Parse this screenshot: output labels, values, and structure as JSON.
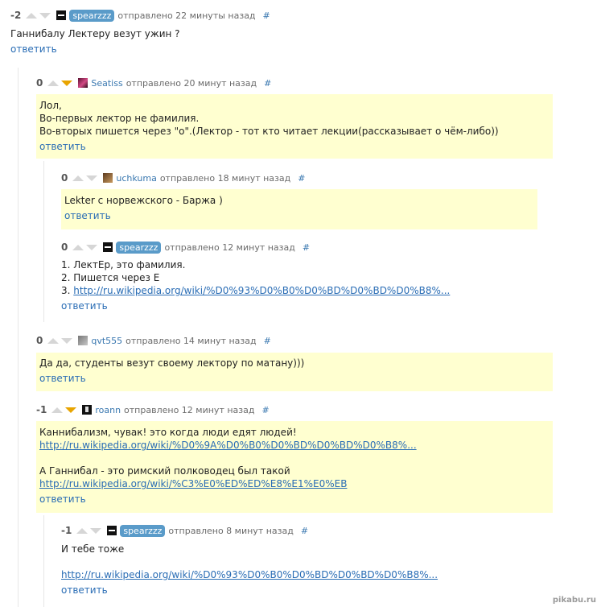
{
  "common": {
    "reply_label": "ответить",
    "hash": "#"
  },
  "comments": [
    {
      "score": "-2",
      "user": "spearzzz",
      "time": "отправлено 22 минуты назад",
      "lines": [
        "Ганнибалу Лектеру везут ужин ?"
      ]
    },
    {
      "score": "0",
      "user": "Seatiss",
      "time": "отправлено 20 минут назад",
      "lines": [
        "Лол,",
        "Во-первых лектор не фамилия.",
        "Во-вторых пишется через \"о\".(Лектор - тот кто читает лекции(рассказывает о чём-либо))"
      ]
    },
    {
      "score": "0",
      "user": "uchkuma",
      "time": "отправлено 18 минут назад",
      "lines": [
        "Lekter с норвежского - Баржа )"
      ]
    },
    {
      "score": "0",
      "user": "spearzzz",
      "time": "отправлено 12 минут назад",
      "lines": [
        "1. ЛектЕр, это фамилия.",
        "2. Пишется через Е",
        "3. "
      ],
      "link": "http://ru.wikipedia.org/wiki/%D0%93%D0%B0%D0%BD%D0%BD%D0%B8%..."
    },
    {
      "score": "0",
      "user": "qvt555",
      "time": "отправлено 14 минут назад",
      "lines": [
        "Да да, студенты везут своему лектору по матану)))"
      ]
    },
    {
      "score": "-1",
      "user": "roann",
      "time": "отправлено 12 минут назад",
      "lines": [
        "Каннибализм, чувак! это когда люди едят людей!",
        "А Ганнибал - это римский полководец был такой"
      ],
      "links": [
        "http://ru.wikipedia.org/wiki/%D0%9A%D0%B0%D0%BD%D0%BD%D0%B8%...",
        "http://ru.wikipedia.org/wiki/%C3%E0%ED%ED%E8%E1%E0%EB"
      ]
    },
    {
      "score": "-1",
      "user": "spearzzz",
      "time": "отправлено 8 минут назад",
      "lines": [
        "И тебе тоже"
      ],
      "link": "http://ru.wikipedia.org/wiki/%D0%93%D0%B0%D0%BD%D0%BD%D0%B8%..."
    }
  ],
  "watermark": "pikabu.ru",
  "colors": {
    "highlight": "#ffffd0",
    "link": "#2a6db5",
    "vote_active": "#e8a400",
    "badge": "#5a9bc9"
  },
  "icons": [
    "upvote-arrow-icon",
    "downvote-arrow-icon",
    "avatar-icon"
  ]
}
